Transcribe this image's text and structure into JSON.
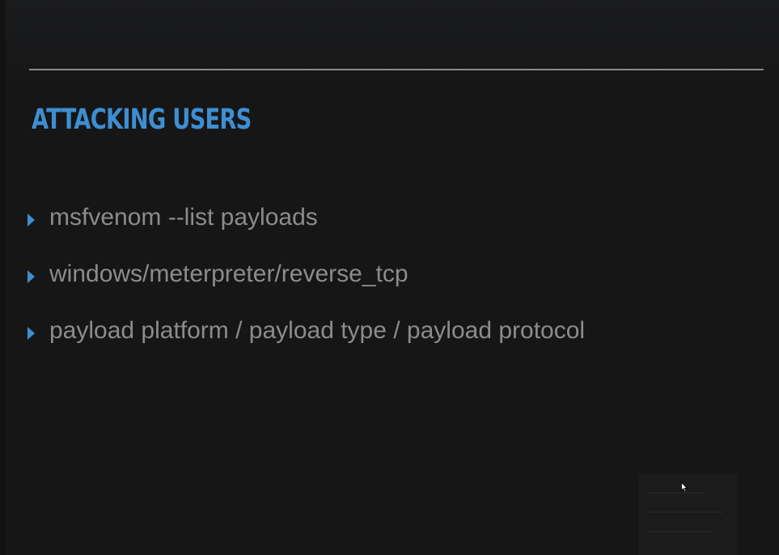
{
  "slide": {
    "title": "ATTACKING USERS",
    "bullets": [
      {
        "text": "msfvenom --list payloads"
      },
      {
        "text": "windows/meterpreter/reverse_tcp"
      },
      {
        "text": "payload platform / payload type / payload protocol"
      }
    ]
  },
  "icons": {
    "bullet": "triangle-right-icon",
    "cursor": "mouse-pointer-icon"
  },
  "colors": {
    "background": "#161616",
    "accent": "#3e8ed0",
    "body_text": "#8c8c8c",
    "rule": "#8a8a8a"
  }
}
